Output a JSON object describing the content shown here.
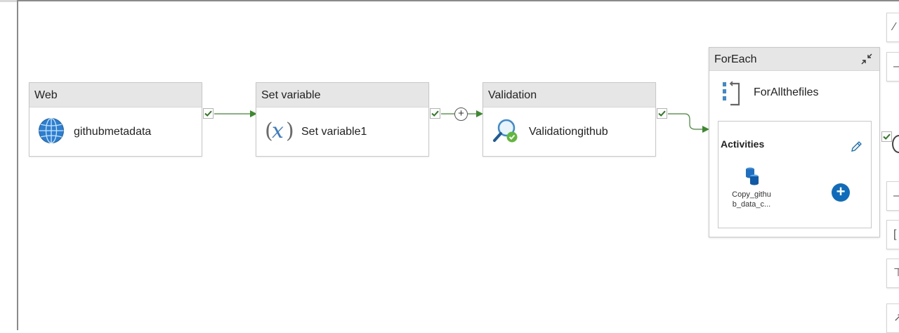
{
  "activities": [
    {
      "type": "Web",
      "name": "githubmetadata",
      "icon": "globe-icon"
    },
    {
      "type": "Set variable",
      "name": "Set variable1",
      "icon": "variable-icon"
    },
    {
      "type": "Validation",
      "name": "Validationgithub",
      "icon": "validation-icon"
    }
  ],
  "foreach": {
    "type": "ForEach",
    "name": "ForAllthefiles",
    "activities_label": "Activities",
    "inner_activity_name": "Copy_githu b_data_c..."
  },
  "colors": {
    "success_green": "#3c8a2e",
    "header_gray": "#e6e6e6",
    "accent_blue": "#0f6cbd"
  },
  "toolbar_icons": [
    "user-icon",
    "minus-icon",
    "minus-icon",
    "fit-icon",
    "layout-icon",
    "expand-icon"
  ]
}
